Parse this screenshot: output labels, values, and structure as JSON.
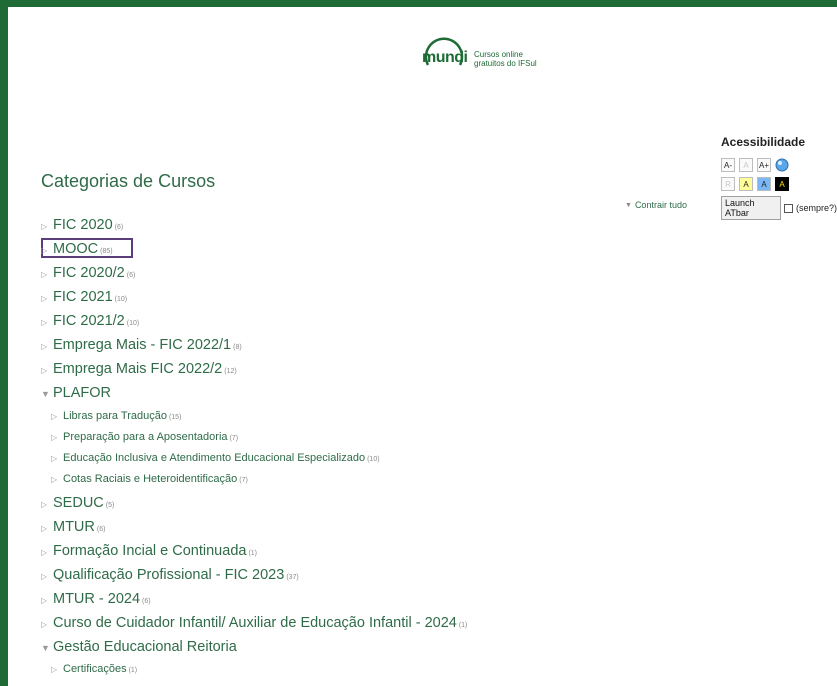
{
  "brand": {
    "logo_word": "mundi",
    "tagline_line1": "Cursos online",
    "tagline_line2": "gratuitos do IFSul",
    "color": "#1e6b35"
  },
  "page": {
    "title": "Categorias de Cursos",
    "collapse_all": "Contrair tudo"
  },
  "categories": [
    {
      "label": "FIC 2020",
      "count": "(6)",
      "expanded": false,
      "level": 0
    },
    {
      "label": "MOOC",
      "count": "(85)",
      "expanded": false,
      "level": 0,
      "highlighted": true
    },
    {
      "label": "FIC 2020/2",
      "count": "(6)",
      "expanded": false,
      "level": 0
    },
    {
      "label": "FIC 2021",
      "count": "(10)",
      "expanded": false,
      "level": 0
    },
    {
      "label": "FIC 2021/2",
      "count": "(10)",
      "expanded": false,
      "level": 0
    },
    {
      "label": "Emprega Mais - FIC 2022/1",
      "count": "(8)",
      "expanded": false,
      "level": 0
    },
    {
      "label": "Emprega Mais   FIC 2022/2",
      "count": "(12)",
      "expanded": false,
      "level": 0
    },
    {
      "label": "PLAFOR",
      "count": "",
      "expanded": true,
      "level": 0
    },
    {
      "label": "Libras para Tradução",
      "count": "(15)",
      "expanded": false,
      "level": 1
    },
    {
      "label": "Preparação para a Aposentadoria",
      "count": "(7)",
      "expanded": false,
      "level": 1
    },
    {
      "label": "Educação Inclusiva e Atendimento Educacional Especializado",
      "count": "(10)",
      "expanded": false,
      "level": 1
    },
    {
      "label": "Cotas Raciais e Heteroidentificação",
      "count": "(7)",
      "expanded": false,
      "level": 1
    },
    {
      "label": "SEDUC",
      "count": "(5)",
      "expanded": false,
      "level": 0
    },
    {
      "label": "MTUR",
      "count": "(6)",
      "expanded": false,
      "level": 0
    },
    {
      "label": "Formação Incial e Continuada",
      "count": "(1)",
      "expanded": false,
      "level": 0
    },
    {
      "label": "Qualificação Profissional - FIC 2023",
      "count": "(37)",
      "expanded": false,
      "level": 0
    },
    {
      "label": "MTUR - 2024",
      "count": "(6)",
      "expanded": false,
      "level": 0
    },
    {
      "label": "Curso de Cuidador Infantil/ Auxiliar de Educação Infantil - 2024",
      "count": "(1)",
      "expanded": false,
      "level": 0
    },
    {
      "label": "Gestão Educacional   Reitoria",
      "count": "",
      "expanded": true,
      "level": 0
    },
    {
      "label": "Certificações",
      "count": "(1)",
      "expanded": false,
      "level": 1
    }
  ],
  "accessibility": {
    "title": "Acessibilidade",
    "font_buttons": [
      "A-",
      "A",
      "A+"
    ],
    "color_buttons": [
      "R",
      "A",
      "A",
      "A"
    ],
    "launch_label": "Launch ATbar",
    "always_label": "(sempre?)"
  },
  "icons": {
    "collapsed": "triangle-right-icon",
    "expanded": "triangle-down-icon"
  }
}
